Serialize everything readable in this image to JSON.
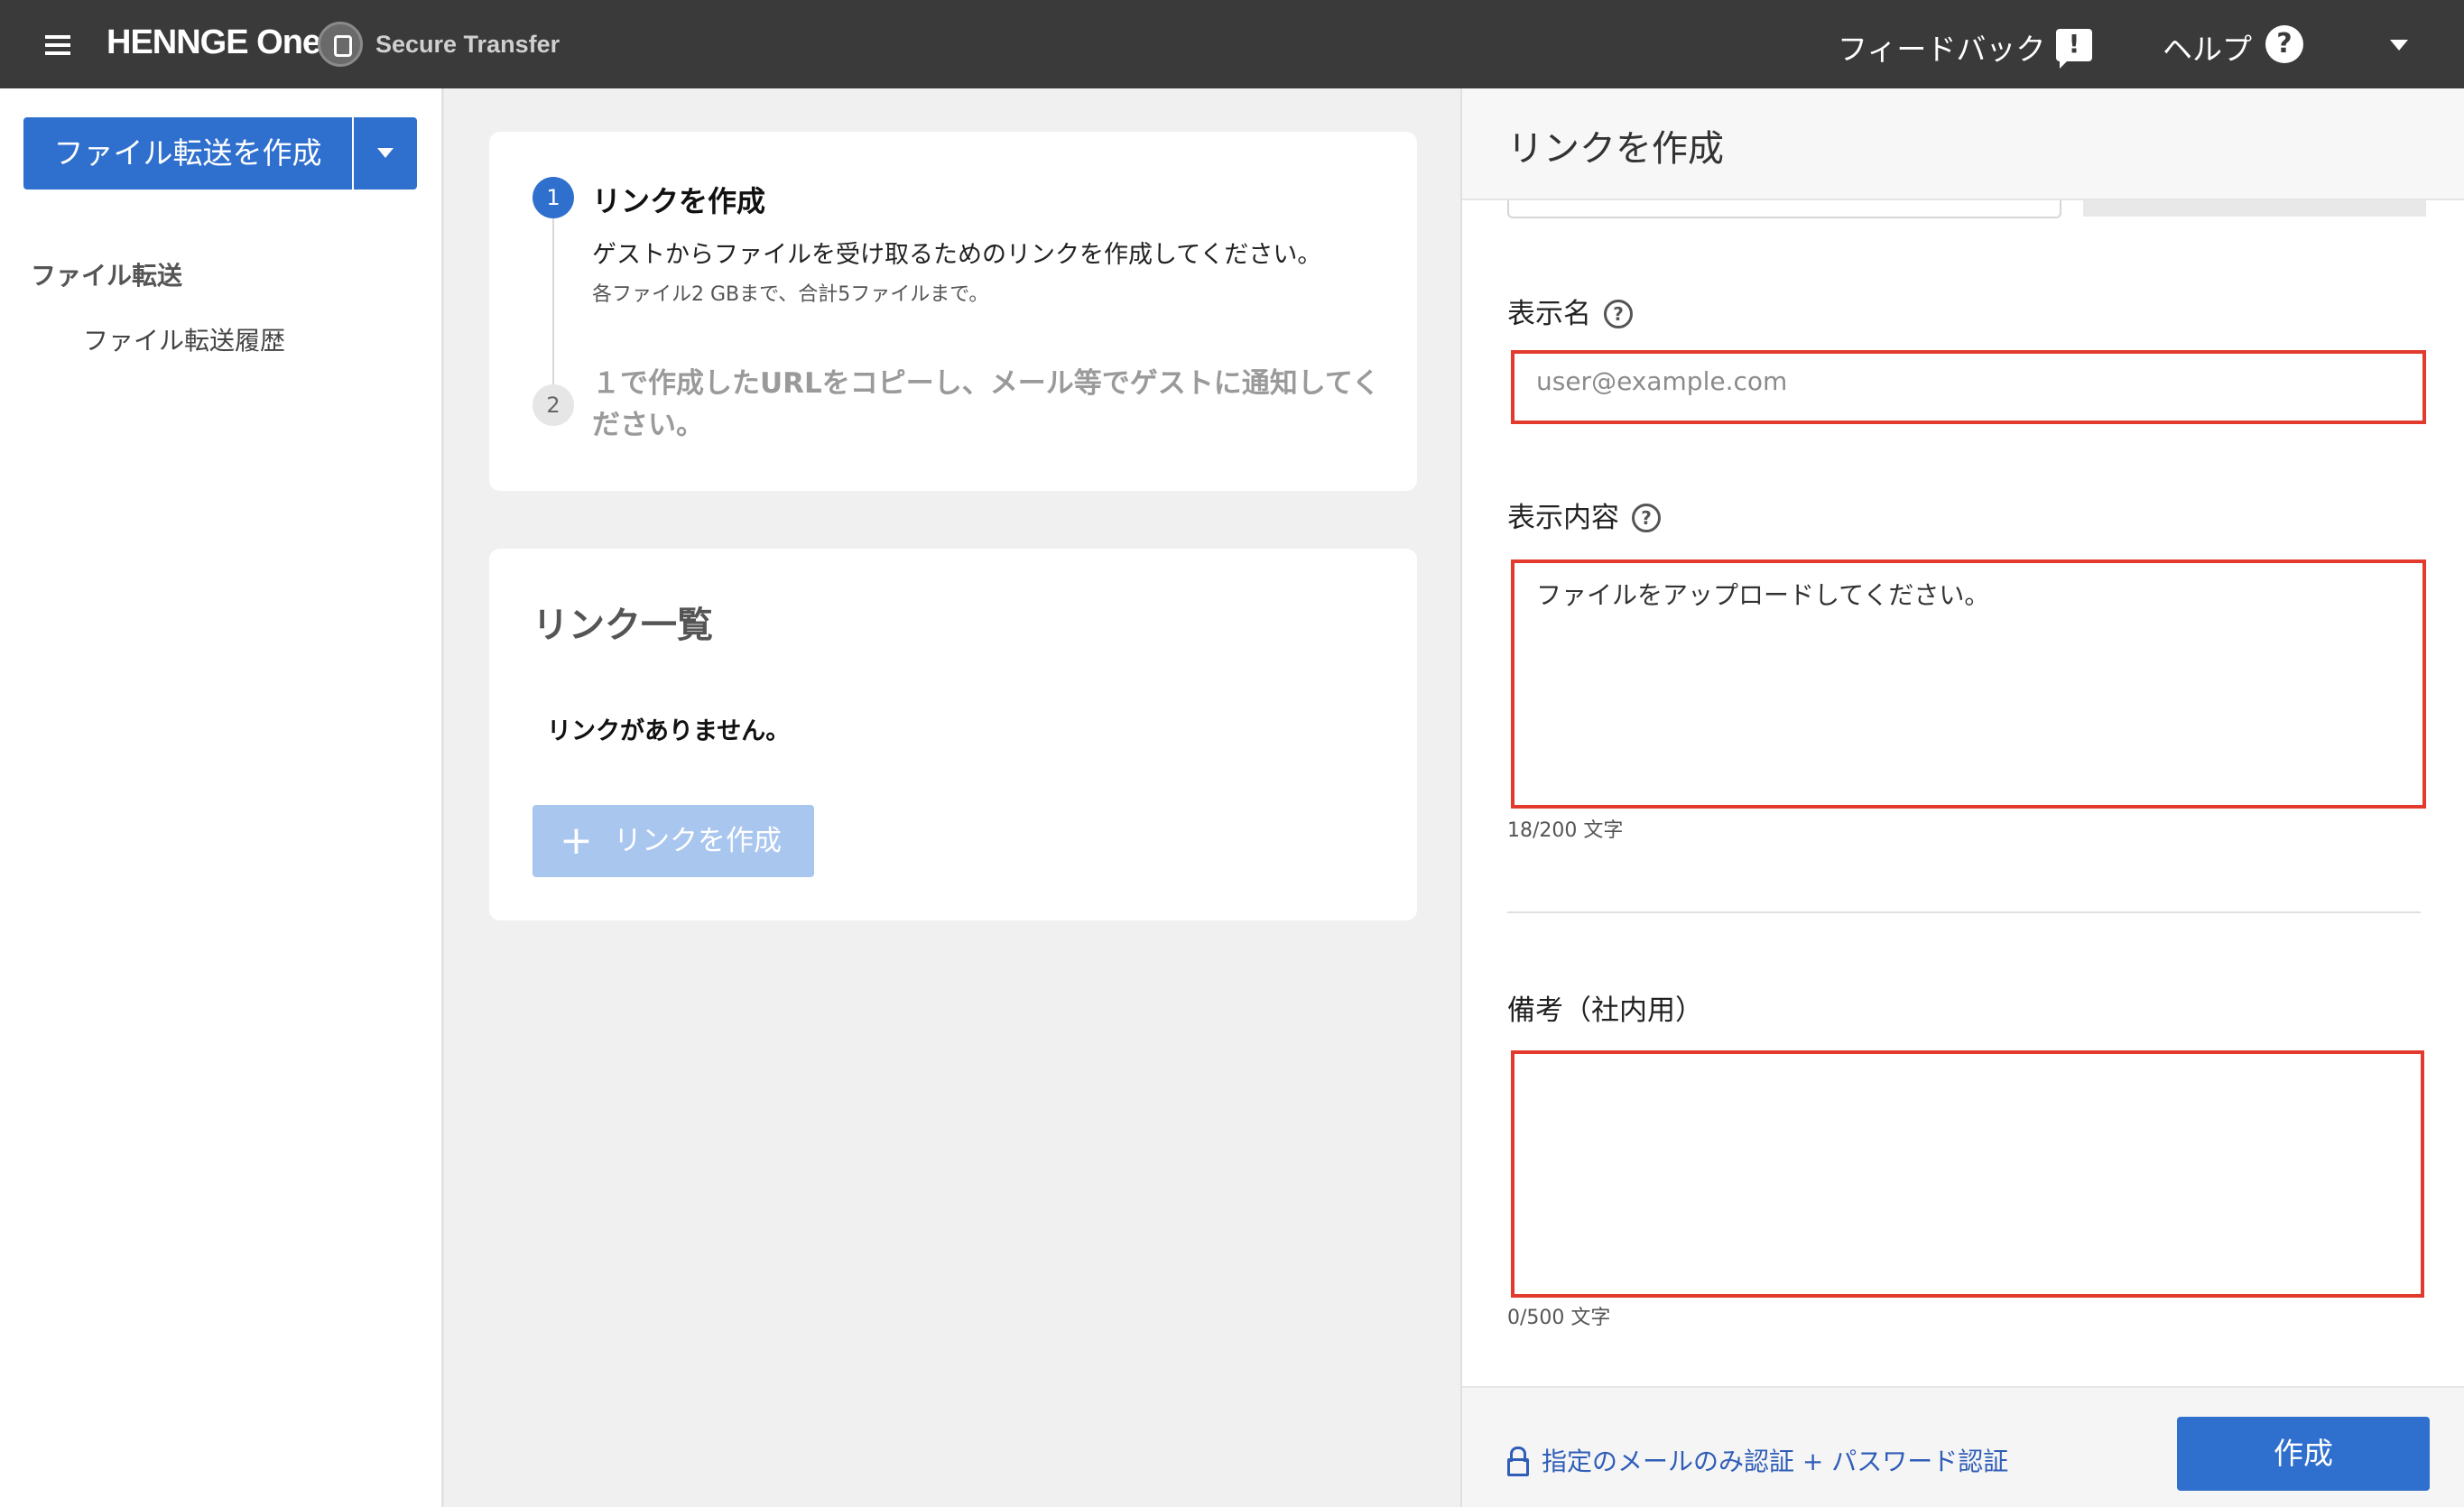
{
  "app": {
    "brand": "HENNGE One",
    "product": "Secure Transfer",
    "feedback_label": "フィードバック",
    "help_label": "ヘルプ"
  },
  "sidebar": {
    "create_button": "ファイル転送を作成",
    "section_title": "ファイル転送",
    "items": [
      {
        "label": "ファイル転送履歴"
      }
    ]
  },
  "steps": [
    {
      "number": "1",
      "title": "リンクを作成",
      "description": "ゲストからファイルを受け取るためのリンクを作成してください。",
      "note": "各ファイル2 GBまで、合計5ファイルまで。"
    },
    {
      "number": "2",
      "title": "１で作成したURLをコピーし、メール等でゲストに通知してください。"
    }
  ],
  "link_list": {
    "title": "リンク一覧",
    "empty_message": "リンクがありません。",
    "create_button": "リンクを作成"
  },
  "panel": {
    "title": "リンクを作成",
    "display_name": {
      "label": "表示名",
      "placeholder": "user@example.com",
      "value": ""
    },
    "display_content": {
      "label": "表示内容",
      "value": "ファイルをアップロードしてください。",
      "counter": "18/200 文字"
    },
    "remarks": {
      "label": "備考（社内用）",
      "value": "",
      "counter": "0/500 文字"
    },
    "auth_link": "指定のメールのみ認証 + パスワード認証",
    "submit_button": "作成"
  },
  "colors": {
    "topbar": "#3a3a3a",
    "primary": "#2f6fce",
    "error_border": "#e23b2d",
    "disabled_button": "#a9c6ef"
  }
}
